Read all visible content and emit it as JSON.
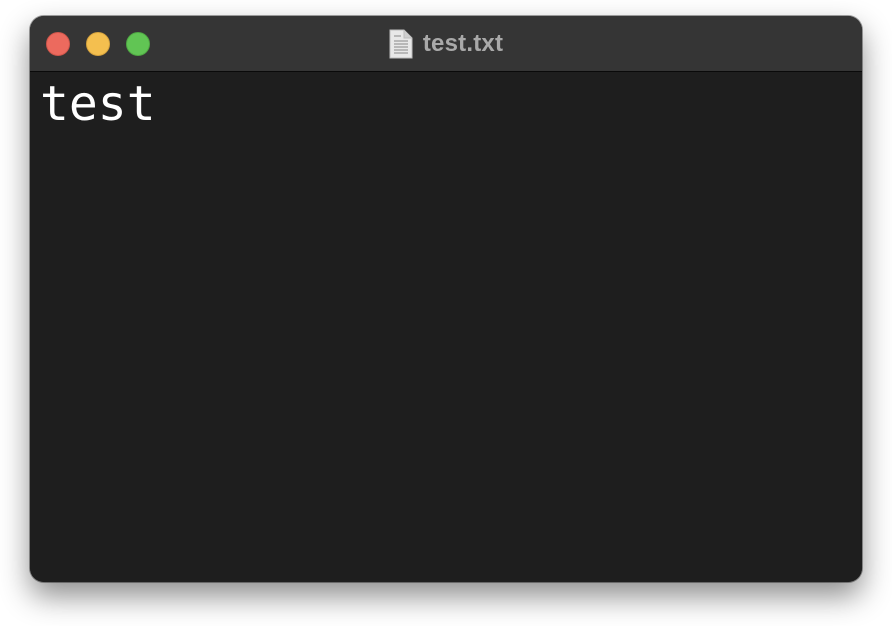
{
  "window": {
    "title": "test.txt",
    "title_icon": "text-document-icon",
    "traffic_lights": {
      "close": {
        "icon": "close-dot",
        "color": "#ec6a5e"
      },
      "minimize": {
        "icon": "minimize-dot",
        "color": "#f4bf4f"
      },
      "zoom": {
        "icon": "zoom-dot",
        "color": "#61c554"
      }
    }
  },
  "editor": {
    "lines": [
      "test"
    ],
    "background": "#1e1e1e",
    "text_color": "#ffffff"
  }
}
